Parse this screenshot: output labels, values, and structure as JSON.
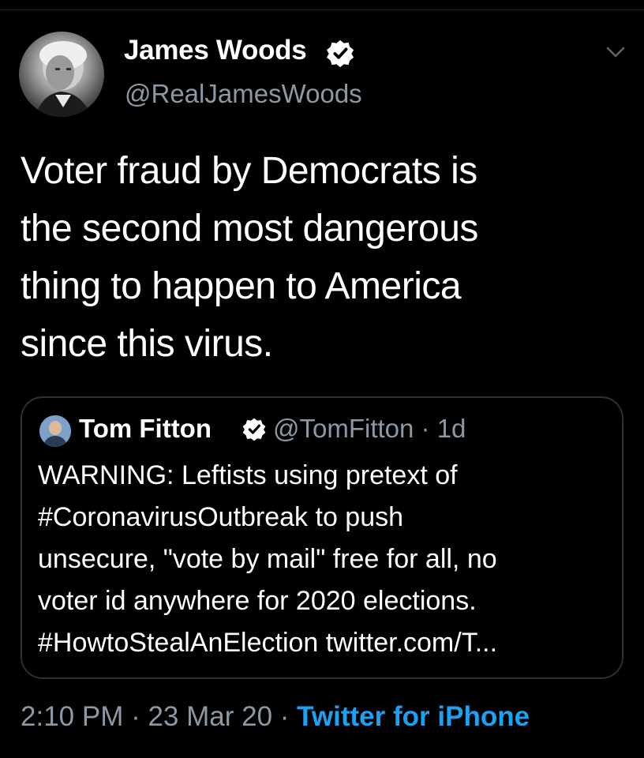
{
  "tweet": {
    "author": {
      "name": "James Woods",
      "handle": "@RealJamesWoods",
      "verified": true
    },
    "text": "Voter fraud by Democrats is\nthe second most dangerous\nthing to happen to America\nsince this virus.",
    "quoted_tweet": {
      "author_name": "Tom Fitton",
      "verified": true,
      "meta": "@TomFitton · 1d",
      "text": "WARNING: Leftists using pretext of\n#CoronavirusOutbreak to push\nunsecure, \"vote by mail\" free for all, no\nvoter id anywhere for 2020 elections.\n#HowtoStealAnElection twitter.com/T..."
    },
    "timestamp": "2:10 PM · 23 Mar 20 · ",
    "source": "Twitter for iPhone"
  },
  "icons": {
    "verified": "verified-check-icon",
    "menu": "chevron-down-icon"
  },
  "colors": {
    "background": "#000000",
    "text_primary": "#ffffff",
    "text_secondary": "#8b98a5",
    "link": "#1da1f2",
    "card_border": "#2b3036"
  }
}
